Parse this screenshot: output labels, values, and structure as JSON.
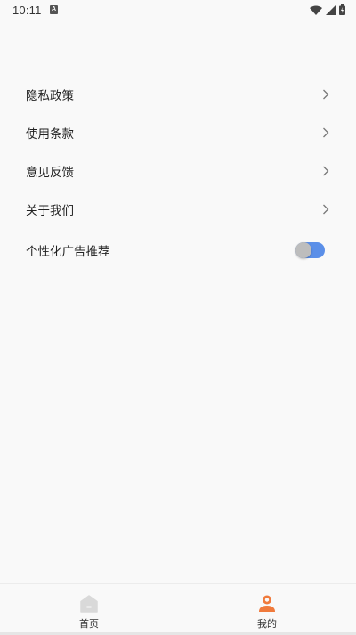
{
  "status_bar": {
    "time": "10:11",
    "app_icon_letter": "A",
    "icons": [
      "wifi-icon",
      "signal-icon",
      "battery-icon"
    ]
  },
  "menu": {
    "items": [
      {
        "label": "隐私政策",
        "icon": "chevron-right-icon"
      },
      {
        "label": "使用条款",
        "icon": "chevron-right-icon"
      },
      {
        "label": "意见反馈",
        "icon": "chevron-right-icon"
      },
      {
        "label": "关于我们",
        "icon": "chevron-right-icon"
      }
    ],
    "toggle": {
      "label": "个性化广告推荐",
      "state": "on",
      "track_color": "#5b8fe8",
      "knob_color": "#bdbdbd"
    }
  },
  "tab_bar": {
    "tabs": [
      {
        "label": "首页",
        "icon": "home-icon",
        "active": false
      },
      {
        "label": "我的",
        "icon": "person-icon",
        "active": true
      }
    ],
    "active_color": "#f07a3c",
    "inactive_color": "#d9d9d9"
  }
}
